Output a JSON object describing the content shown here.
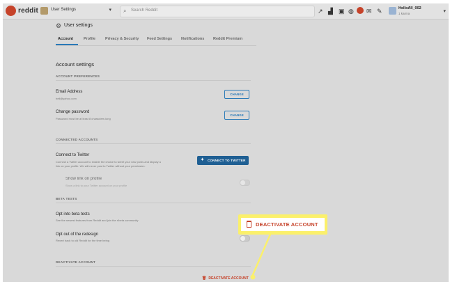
{
  "topbar": {
    "logo_text": "reddit",
    "section_label": "User Settings",
    "search_placeholder": "Search Reddit",
    "username": "HelloAll_002",
    "karma": "1 karma"
  },
  "settings": {
    "title": "User settings",
    "tabs": [
      "Account",
      "Profile",
      "Privacy & Security",
      "Feed Settings",
      "Notifications",
      "Reddit Premium"
    ],
    "heading": "Account settings"
  },
  "account_preferences": {
    "header": "ACCOUNT PREFERENCES",
    "email_title": "Email Address",
    "email_value": "hell@yahoo.com",
    "email_button": "CHANGE",
    "password_title": "Change password",
    "password_sub": "Password must be at least 8 characters long",
    "password_button": "CHANGE"
  },
  "connected_accounts": {
    "header": "CONNECTED ACCOUNTS",
    "twitter_title": "Connect to Twitter",
    "twitter_sub_1": "Connect a Twitter account to enable the choice to tweet your new posts and display a",
    "twitter_sub_2": "link on your profile. We will never post to Twitter without your permission.",
    "twitter_button": "CONNECT TO TWITTER",
    "show_link_title": "Show link on profile",
    "show_link_sub": "Show a link to your Twitter account on your profile"
  },
  "beta_tests": {
    "header": "BETA TESTS",
    "opt_in_title": "Opt into beta tests",
    "opt_in_sub": "See the newest features from Reddit and join the r/beta community",
    "opt_out_title": "Opt out of the redesign",
    "opt_out_sub": "Revert back to old Reddit for the time being"
  },
  "deactivate": {
    "header": "DEACTIVATE ACCOUNT",
    "button": "DEACTIVATE ACCOUNT"
  },
  "callout": {
    "label": "DEACTIVATE ACCOUNT",
    "color": "#fbf06b"
  },
  "colors": {
    "accent": "#2a7ab8",
    "danger": "#c6432a",
    "twitter": "#1f5f93"
  }
}
